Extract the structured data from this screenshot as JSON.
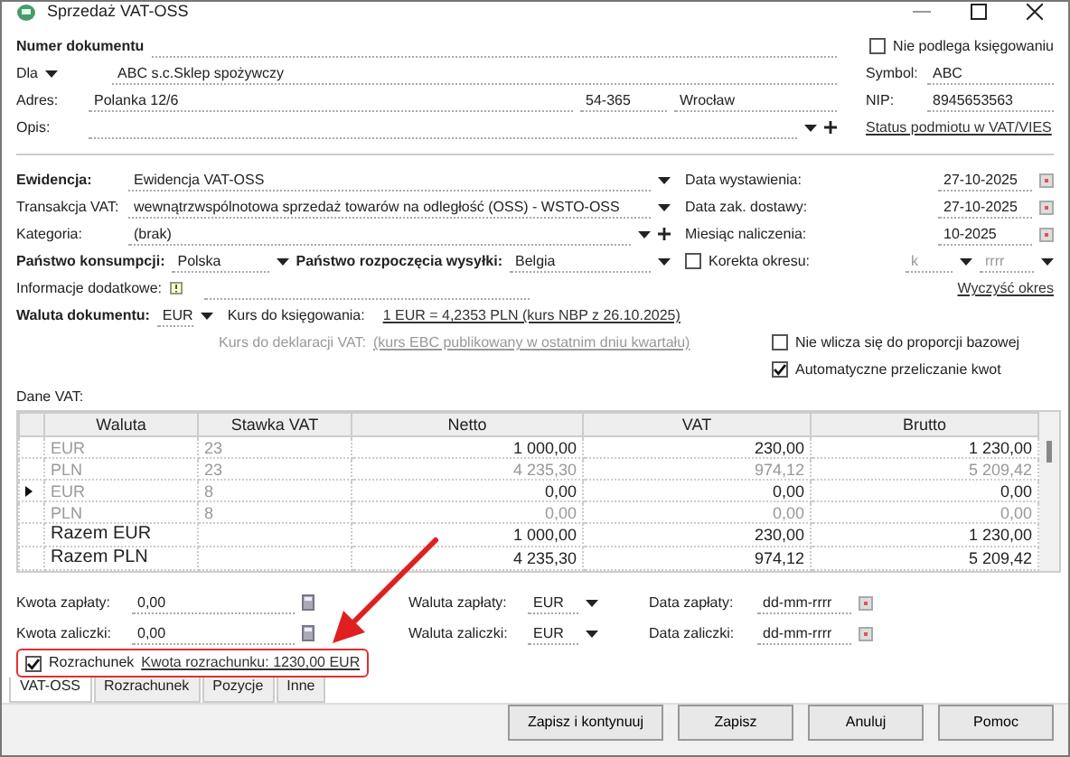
{
  "window": {
    "title": "Sprzedaż VAT-OSS"
  },
  "header": {
    "document_number": {
      "label": "Numer dokumentu"
    },
    "for": {
      "label": "Dla",
      "value": "ABC s.c.Sklep spożywczy"
    },
    "address": {
      "label": "Adres:",
      "street": "Polanka  12/6",
      "postal_code": "54-365",
      "city": "Wrocław"
    },
    "description": {
      "label": "Opis:"
    },
    "not_booked": {
      "label": "Nie podlega księgowaniu",
      "checked": false
    },
    "symbol": {
      "label": "Symbol:",
      "value": "ABC"
    },
    "nip": {
      "label": "NIP:",
      "value": "8945653563"
    },
    "status_link": "Status podmiotu w VAT/VIES"
  },
  "register": {
    "label": "Ewidencja:",
    "value": "Ewidencja VAT-OSS"
  },
  "vat_transaction": {
    "label": "Transakcja VAT:",
    "value": "wewnątrzwspólnotowa sprzedaż towarów na odległość (OSS) - WSTO-OSS"
  },
  "category": {
    "label": "Kategoria:",
    "value": "(brak)"
  },
  "consumption_country": {
    "label": "Państwo konsumpcji:",
    "value": "Polska"
  },
  "dispatch_country": {
    "label": "Państwo rozpoczęcia wysyłki:",
    "value": "Belgia"
  },
  "additional_info": {
    "label": "Informacje dodatkowe:"
  },
  "currency": {
    "label": "Waluta dokumentu:",
    "value": "EUR"
  },
  "booking_rate": {
    "label": "Kurs do księgowania:",
    "link": "1 EUR = 4,2353 PLN (kurs NBP z 26.10.2025)"
  },
  "declaration_rate": {
    "label": "Kurs do deklaracji VAT:",
    "link": "(kurs EBC publikowany w ostatnim dniu kwartału)",
    "disabled": true
  },
  "dates": [
    {
      "label": "Data wystawienia:",
      "value": "27-10-2025"
    },
    {
      "label": "Data zak. dostawy:",
      "value": "27-10-2025"
    },
    {
      "label": "Miesiąc naliczenia:",
      "value": "10-2025"
    }
  ],
  "period_correction": {
    "label": "Korekta okresu:",
    "checked": false,
    "quarter": "k",
    "year": "rrrr"
  },
  "clear_period_link": "Wyczyść okres",
  "exclude_base": {
    "label": "Nie wlicza się do proporcji bazowej",
    "checked": false
  },
  "auto_convert": {
    "label": "Automatyczne przeliczanie kwot",
    "checked": true
  },
  "vat_data": {
    "label": "Dane VAT:",
    "columns": [
      "Waluta",
      "Stawka VAT",
      "Netto",
      "VAT",
      "Brutto"
    ],
    "rows": [
      {
        "kind": "rate",
        "currency": "EUR",
        "rate": "23",
        "netto": "1 000,00",
        "vat": "230,00",
        "brutto": "1 230,00",
        "dimmed": false,
        "current": false
      },
      {
        "kind": "rate",
        "currency": "PLN",
        "rate": "23",
        "netto": "4 235,30",
        "vat": "974,12",
        "brutto": "5 209,42",
        "dimmed": true,
        "current": false
      },
      {
        "kind": "rate",
        "currency": "EUR",
        "rate": "8",
        "netto": "0,00",
        "vat": "0,00",
        "brutto": "0,00",
        "dimmed": false,
        "current": true
      },
      {
        "kind": "rate",
        "currency": "PLN",
        "rate": "8",
        "netto": "0,00",
        "vat": "0,00",
        "brutto": "0,00",
        "dimmed": true,
        "current": false
      },
      {
        "kind": "total",
        "label": "Razem EUR",
        "netto": "1 000,00",
        "vat": "230,00",
        "brutto": "1 230,00"
      },
      {
        "kind": "total",
        "label": "Razem PLN",
        "netto": "4 235,30",
        "vat": "974,12",
        "brutto": "5 209,42"
      }
    ]
  },
  "payments": [
    {
      "amount_label": "Kwota zapłaty:",
      "amount": "0,00",
      "currency_label": "Waluta zapłaty:",
      "currency": "EUR",
      "date_label": "Data zapłaty:",
      "date_placeholder": "dd-mm-rrrr"
    },
    {
      "amount_label": "Kwota zaliczki:",
      "amount": "0,00",
      "currency_label": "Waluta zaliczki:",
      "currency": "EUR",
      "date_label": "Data zaliczki:",
      "date_placeholder": "dd-mm-rrrr"
    }
  ],
  "settlement": {
    "label": "Rozrachunek",
    "checked": true,
    "link": "Kwota rozrachunku: 1230,00 EUR"
  },
  "tabs": [
    {
      "label": "VAT-OSS",
      "selected": true
    },
    {
      "label": "Rozrachunek",
      "selected": false
    },
    {
      "label": "Pozycje",
      "selected": false
    },
    {
      "label": "Inne",
      "selected": false
    }
  ],
  "buttons": [
    "Zapisz i kontynuuj",
    "Zapisz",
    "Anuluj",
    "Pomoc"
  ]
}
